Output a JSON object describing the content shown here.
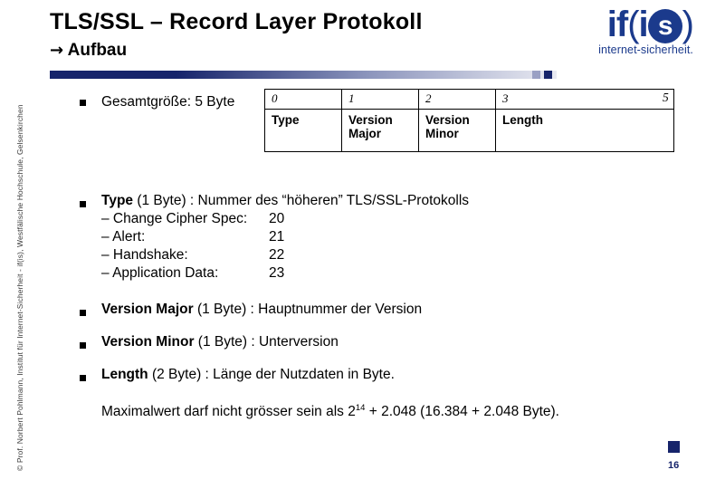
{
  "slide": {
    "title": "TLS/SSL – Record Layer Protokoll",
    "subtitle_arrow": "→",
    "subtitle": "Aufbau",
    "page_number": "16",
    "side_credit": "© Prof. Norbert Pohlmann, Institut für Internet-Sicherheit - if(is), Westfälische Hochschule, Gelsenkirchen"
  },
  "logo": {
    "if_text": "if",
    "paren_open": "(",
    "s_text": "i",
    "s_circle": "s",
    "paren_close": ")",
    "tagline": "internet-sicherheit."
  },
  "bullets": {
    "b1": "Gesamtgröße: 5 Byte",
    "b2_bold": "Type",
    "b2_rest": " (1 Byte) : Nummer des “höheren” TLS/SSL-Protokolls",
    "b3_bold": "Version Major",
    "b3_rest": " (1 Byte) : Hauptnummer der Version",
    "b4_bold": "Version Minor",
    "b4_rest": " (1 Byte) : Unterversion",
    "b5_bold": "Length",
    "b5_rest": " (2 Byte) : Länge der Nutzdaten in Byte."
  },
  "sublist": [
    {
      "label": "– Change Cipher Spec:",
      "value": "20"
    },
    {
      "label": "– Alert:",
      "value": "21"
    },
    {
      "label": "– Handshake:",
      "value": "22"
    },
    {
      "label": "– Application Data:",
      "value": "23"
    }
  ],
  "packet_table": {
    "offsets": [
      "0",
      "1",
      "2",
      "3"
    ],
    "offset_end": "5",
    "fields": [
      "Type",
      "Version Major",
      "Version Minor",
      "Length"
    ],
    "fields_line1": [
      "Type",
      "Version",
      "Version",
      "Length"
    ],
    "fields_line2": [
      "",
      "Major",
      "Minor",
      ""
    ]
  },
  "note": {
    "part1": "Maximalwert darf nicht grösser sein als 2",
    "exp": "14",
    "part2": " + 2.048 (16.384 + 2.048 Byte)."
  },
  "colors": {
    "brand_blue": "#16246b",
    "logo_blue": "#1b3a8c"
  }
}
